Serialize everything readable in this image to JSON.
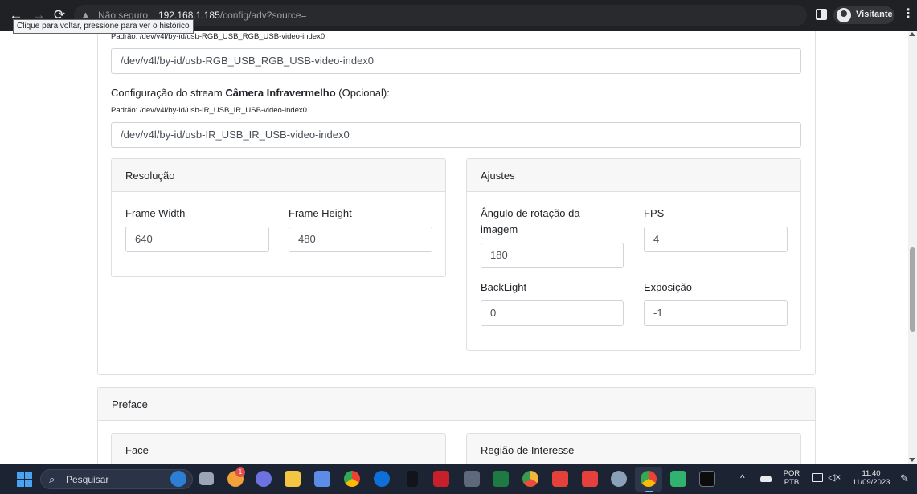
{
  "browser": {
    "back_tooltip": "Clique para voltar, pressione para ver o histórico",
    "not_secure": "Não seguro",
    "url_host": "192.168.1.185",
    "url_path": "/config/adv?source=",
    "profile_label": "Visitante"
  },
  "page": {
    "rgb_default_hint": "Padrão: /dev/v4l/by-id/usb-RGB_USB_RGB_USB-video-index0",
    "rgb_stream_value": "/dev/v4l/by-id/usb-RGB_USB_RGB_USB-video-index0",
    "ir_label_prefix": "Configuração do stream ",
    "ir_label_bold": "Câmera Infravermelho",
    "ir_label_suffix": " (Opcional):",
    "ir_default_hint": "Padrão: /dev/v4l/by-id/usb-IR_USB_IR_USB-video-index0",
    "ir_stream_value": "/dev/v4l/by-id/usb-IR_USB_IR_USB-video-index0",
    "resolution": {
      "header": "Resolução",
      "width_label": "Frame Width",
      "width_value": "640",
      "height_label": "Frame Height",
      "height_value": "480"
    },
    "adjustments": {
      "header": "Ajustes",
      "rotation_label_1": "Ângulo de rotação da",
      "rotation_label_2": "imagem",
      "rotation_value": "180",
      "fps_label": "FPS",
      "fps_value": "4",
      "backlight_label": "BackLight",
      "backlight_value": "0",
      "exposure_label": "Exposição",
      "exposure_value": "-1"
    },
    "preface": {
      "header": "Preface",
      "face_header": "Face",
      "roi_header": "Região de Interesse"
    }
  },
  "taskbar": {
    "search_placeholder": "Pesquisar",
    "notification_badge": "1",
    "lang_top": "POR",
    "lang_bottom": "PTB",
    "time": "11:40",
    "date": "11/09/2023",
    "apps": [
      "bing-icon",
      "task-view-icon",
      "notification-app-icon",
      "chat-icon",
      "file-explorer-icon",
      "snipping-tool-icon",
      "chrome-icon",
      "teamviewer-icon",
      "terminal-dark-icon",
      "evo-icon",
      "calculator-icon",
      "excel-icon",
      "chrome-canary-icon",
      "anydesk-icon",
      "anydesk-2-icon",
      "settings-icon",
      "chrome-active-icon",
      "power-automate-icon",
      "cmd-icon"
    ]
  }
}
